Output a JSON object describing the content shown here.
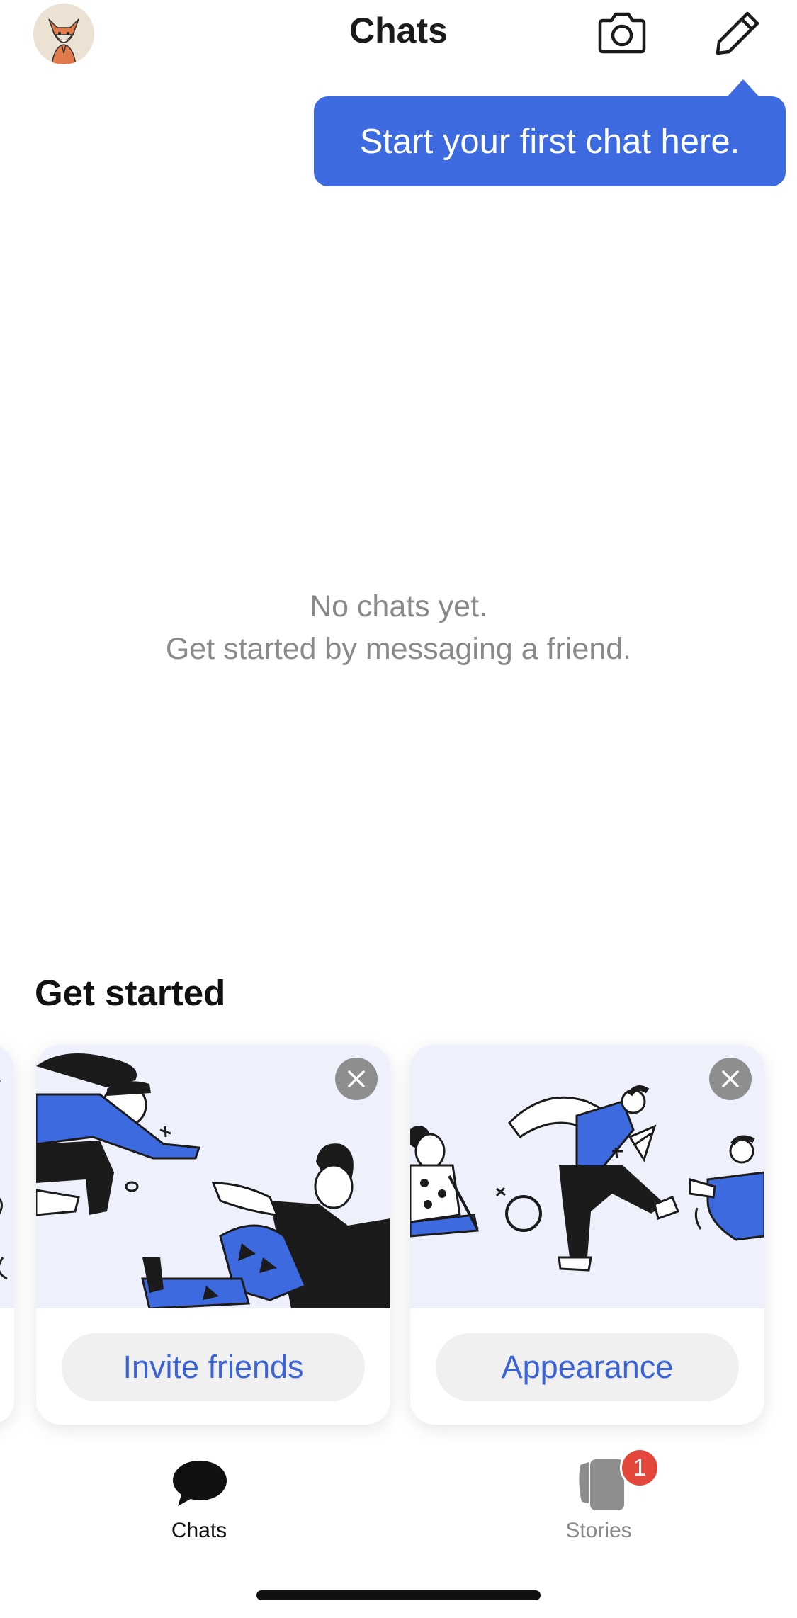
{
  "header": {
    "title": "Chats",
    "avatar_icon": "fox-avatar-icon",
    "camera_icon": "camera-icon",
    "compose_icon": "pencil-icon"
  },
  "tooltip": {
    "text": "Start your first chat here."
  },
  "empty_state": {
    "line1": "No chats yet.",
    "line2": "Get started by messaging a friend."
  },
  "get_started": {
    "title": "Get started",
    "cards": [
      {
        "button_label": "Invite friends",
        "close_icon": "close-icon"
      },
      {
        "button_label": "Appearance",
        "close_icon": "close-icon"
      }
    ]
  },
  "tabbar": {
    "tabs": [
      {
        "label": "Chats",
        "icon": "chat-bubble-icon",
        "selected": true
      },
      {
        "label": "Stories",
        "icon": "stories-icon",
        "selected": false,
        "badge": "1"
      }
    ]
  },
  "colors": {
    "accent": "#3e6ae0",
    "button_text": "#3b63d8",
    "badge": "#e3463a",
    "illustration_bg": "#eef0fb"
  }
}
